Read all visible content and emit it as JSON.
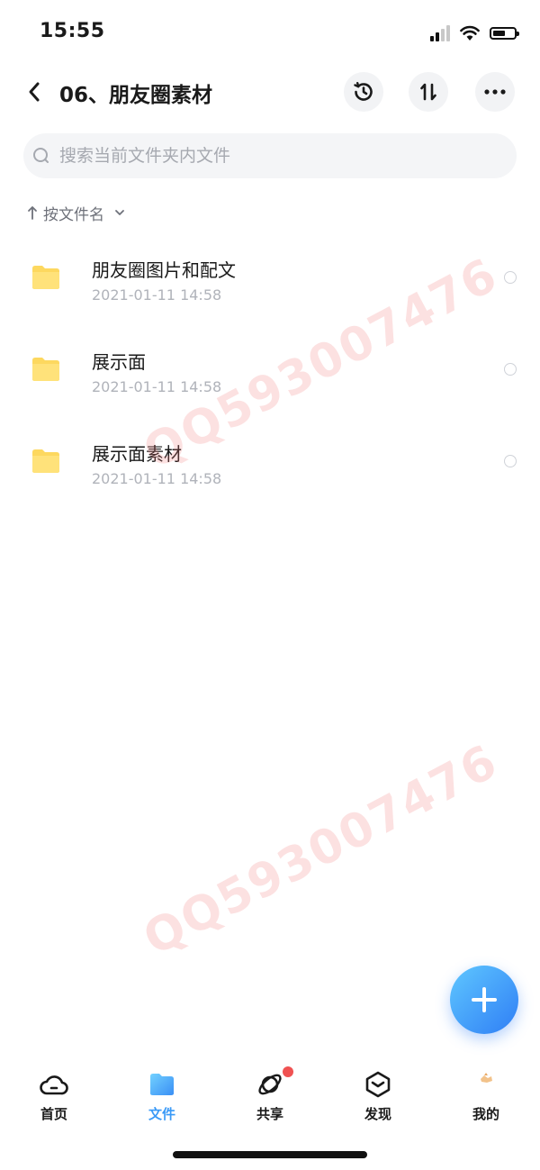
{
  "status_bar": {
    "time": "15:55",
    "battery_level": 0.6
  },
  "header": {
    "title": "06、朋友圈素材",
    "icons": {
      "back": "chevron-left-icon",
      "history": "history-icon",
      "sort": "sort-icon",
      "more": "more-icon"
    }
  },
  "search": {
    "placeholder": "搜索当前文件夹内文件",
    "value": ""
  },
  "sort": {
    "label": "按文件名"
  },
  "files": [
    {
      "name": "朋友圈图片和配文",
      "date": "2021-01-11 14:58"
    },
    {
      "name": "展示面",
      "date": "2021-01-11 14:58"
    },
    {
      "name": "展示面素材",
      "date": "2021-01-11 14:58"
    }
  ],
  "watermark": "QQ593007476",
  "tabs": [
    {
      "label": "首页",
      "icon": "cloud-home-icon"
    },
    {
      "label": "文件",
      "icon": "folder-icon",
      "active": true
    },
    {
      "label": "共享",
      "icon": "orbit-share-icon",
      "badge": true
    },
    {
      "label": "发现",
      "icon": "cube-discover-icon"
    },
    {
      "label": "我的",
      "icon": "avatar-icon"
    }
  ],
  "colors": {
    "accent": "#3a9af7",
    "folder": "#fdd85f",
    "badge": "#f05252"
  }
}
